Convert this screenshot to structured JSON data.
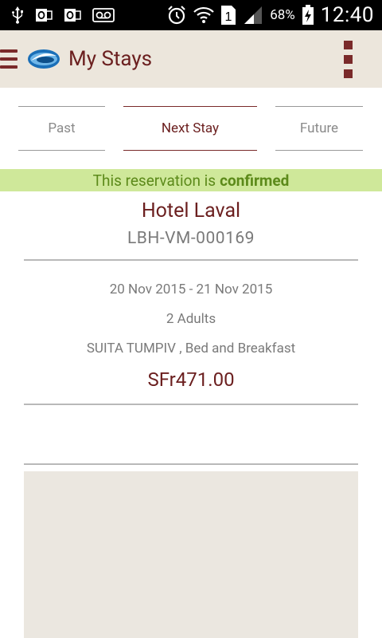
{
  "status_bar": {
    "battery_percent": "68%",
    "time": "12:40",
    "sim_slot": "1",
    "icons": [
      "usb-icon",
      "outlook-icon",
      "outlook-icon",
      "voicemail-icon",
      "alarm-icon",
      "wifi-icon",
      "sim-icon",
      "signal-icon",
      "battery-charging-icon"
    ]
  },
  "action_bar": {
    "title": "My Stays",
    "menu_icon": "hamburger-icon",
    "logo_icon": "app-logo",
    "overflow_icon": "overflow-menu-icon"
  },
  "tabs": [
    {
      "label": "Past",
      "selected": false
    },
    {
      "label": "Next Stay",
      "selected": true
    },
    {
      "label": "Future",
      "selected": false
    }
  ],
  "banner": {
    "prefix": "This reservation is",
    "status": "confirmed"
  },
  "reservation": {
    "hotel_name": "Hotel Laval",
    "code": "LBH-VM-000169",
    "dates": "20 Nov 2015 - 21 Nov 2015",
    "guests": "2 Adults",
    "room": "SUITA TUMPIV , Bed and Breakfast",
    "price": "SFr471.00"
  },
  "colors": {
    "brand": "#6b1f1f",
    "action_bar_bg": "#ece6dc",
    "banner_bg": "#cfe89a",
    "banner_text": "#5c8a1a",
    "map_bg": "#ebe7e0"
  }
}
